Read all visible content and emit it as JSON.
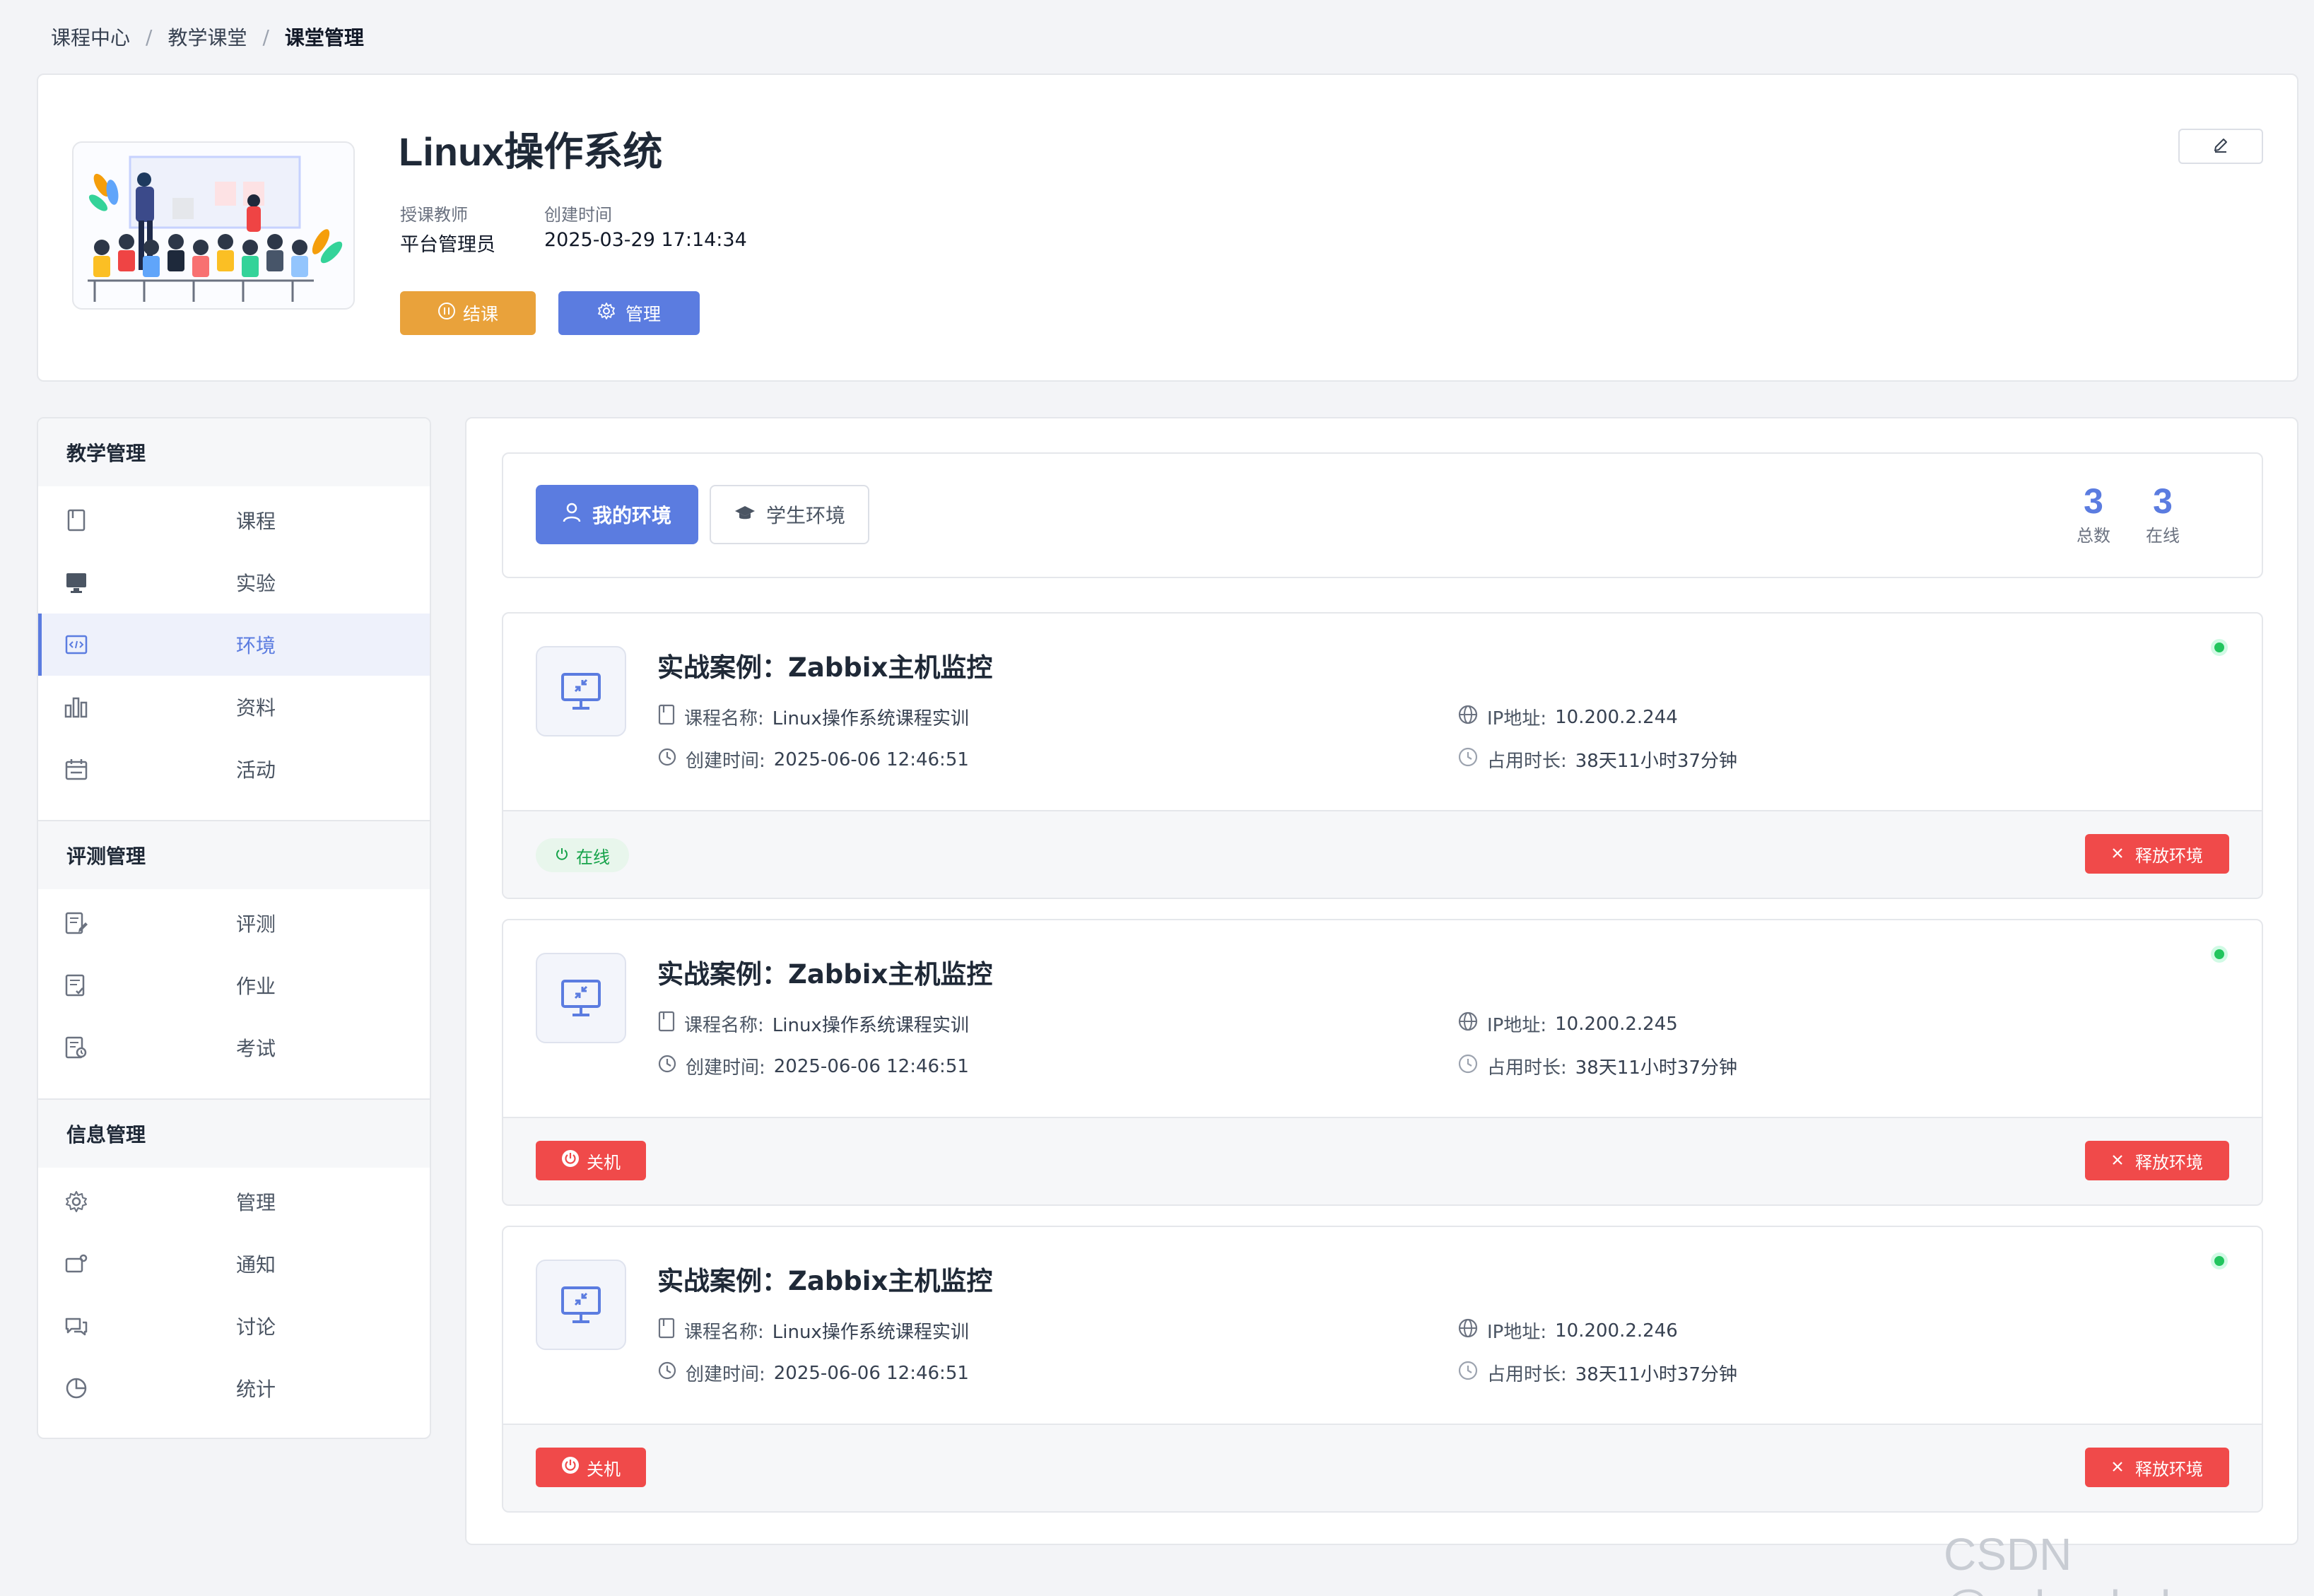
{
  "breadcrumb": {
    "items": [
      "课程中心",
      "教学课堂"
    ],
    "current": "课堂管理",
    "separator": "/"
  },
  "course": {
    "title": "Linux操作系统",
    "teacher_label": "授课教师",
    "teacher_value": "平台管理员",
    "created_label": "创建时间",
    "created_value": "2025-03-29 17:14:34",
    "end_button": "结课",
    "manage_button": "管理"
  },
  "sidebar": {
    "sections": [
      {
        "title": "教学管理",
        "items": [
          {
            "label": "课程",
            "icon": "book-icon"
          },
          {
            "label": "实验",
            "icon": "monitor-icon"
          },
          {
            "label": "环境",
            "icon": "code-window-icon",
            "active": true
          },
          {
            "label": "资料",
            "icon": "bar-chart-icon"
          },
          {
            "label": "活动",
            "icon": "calendar-icon"
          }
        ]
      },
      {
        "title": "评测管理",
        "items": [
          {
            "label": "评测",
            "icon": "edit-doc-icon"
          },
          {
            "label": "作业",
            "icon": "check-doc-icon"
          },
          {
            "label": "考试",
            "icon": "exam-doc-icon"
          }
        ]
      },
      {
        "title": "信息管理",
        "items": [
          {
            "label": "管理",
            "icon": "gear-icon"
          },
          {
            "label": "通知",
            "icon": "notice-icon"
          },
          {
            "label": "讨论",
            "icon": "chat-icon"
          },
          {
            "label": "统计",
            "icon": "pie-chart-icon"
          }
        ]
      }
    ]
  },
  "tabs": {
    "mine": "我的环境",
    "students": "学生环境"
  },
  "stats": {
    "total_value": "3",
    "total_label": "总数",
    "online_value": "3",
    "online_label": "在线"
  },
  "envs": [
    {
      "title": "实战案例：Zabbix主机监控",
      "course_key": "课程名称:",
      "course_val": "Linux操作系统课程实训",
      "created_key": "创建时间:",
      "created_val": "2025-06-06 12:46:51",
      "ip_key": "IP地址:",
      "ip_val": "10.200.2.244",
      "dur_key": "占用时长:",
      "dur_val": "38天11小时37分钟",
      "status_label": "在线",
      "release_label": "释放环境"
    },
    {
      "title": "实战案例：Zabbix主机监控",
      "course_key": "课程名称:",
      "course_val": "Linux操作系统课程实训",
      "created_key": "创建时间:",
      "created_val": "2025-06-06 12:46:51",
      "ip_key": "IP地址:",
      "ip_val": "10.200.2.245",
      "dur_key": "占用时长:",
      "dur_val": "38天11小时37分钟",
      "status_label": "关机",
      "release_label": "释放环境"
    },
    {
      "title": "实战案例：Zabbix主机监控",
      "course_key": "课程名称:",
      "course_val": "Linux操作系统课程实训",
      "created_key": "创建时间:",
      "created_val": "2025-06-06 12:46:51",
      "ip_key": "IP地址:",
      "ip_val": "10.200.2.246",
      "dur_key": "占用时长:",
      "dur_val": "38天11小时37分钟",
      "status_label": "关机",
      "release_label": "释放环境"
    }
  ],
  "colors": {
    "primary": "#5b7ce0",
    "warning": "#e9a23b",
    "danger": "#f04a4a",
    "success": "#22c55e"
  },
  "watermark": "CSDN @zcloudedu"
}
